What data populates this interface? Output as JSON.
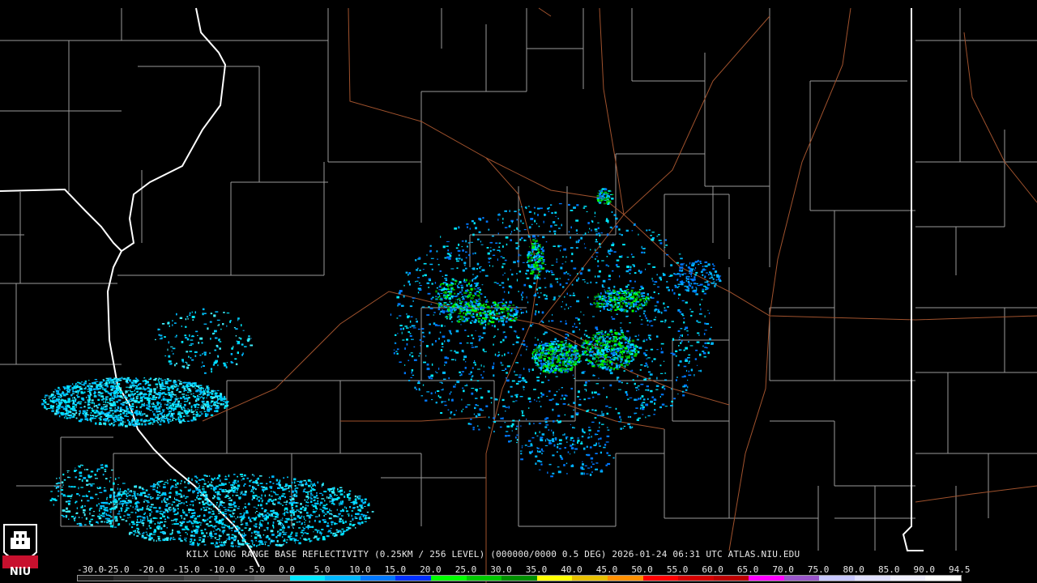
{
  "product": {
    "caption": "KILX LONG RANGE BASE REFLECTIVITY (0.25KM / 256 LEVEL) (000000/0000 0.5 DEG) 2026-01-24 06:31 UTC  ATLAS.NIU.EDU",
    "radar_site": "KILX",
    "timestamp": "2026-01-24 06:31 UTC",
    "elevation": "0.5 DEG",
    "source": "ATLAS.NIU.EDU"
  },
  "logo": {
    "text": "NIU"
  },
  "colors": {
    "background": "#000000",
    "county_lines": "#9a9a9a",
    "state_lines": "#ffffff",
    "roads": "#a0522d"
  },
  "scale": {
    "labels": [
      "-30.0",
      "-25.0",
      "-20.0",
      "-15.0",
      "-10.0",
      "-5.0",
      "0.0",
      "5.0",
      "10.0",
      "15.0",
      "20.0",
      "25.0",
      "30.0",
      "35.0",
      "40.0",
      "45.0",
      "50.0",
      "55.0",
      "60.0",
      "65.0",
      "70.0",
      "75.0",
      "80.0",
      "85.0",
      "90.0",
      "94.5"
    ],
    "colors": [
      "#1a1a1a",
      "#2a2a2a",
      "#3a3a3a",
      "#4a4a4a",
      "#5a5a5a",
      "#6a6a6a",
      "#00e8ff",
      "#00b8ff",
      "#0078ff",
      "#0030ff",
      "#00ff00",
      "#00c800",
      "#009000",
      "#ffff00",
      "#e8c000",
      "#ff9000",
      "#ff0000",
      "#d40000",
      "#bc0000",
      "#ff00ff",
      "#9955c9",
      "#c8c8ff",
      "#e0e0ff",
      "#f0f0ff",
      "#ffffff"
    ]
  }
}
